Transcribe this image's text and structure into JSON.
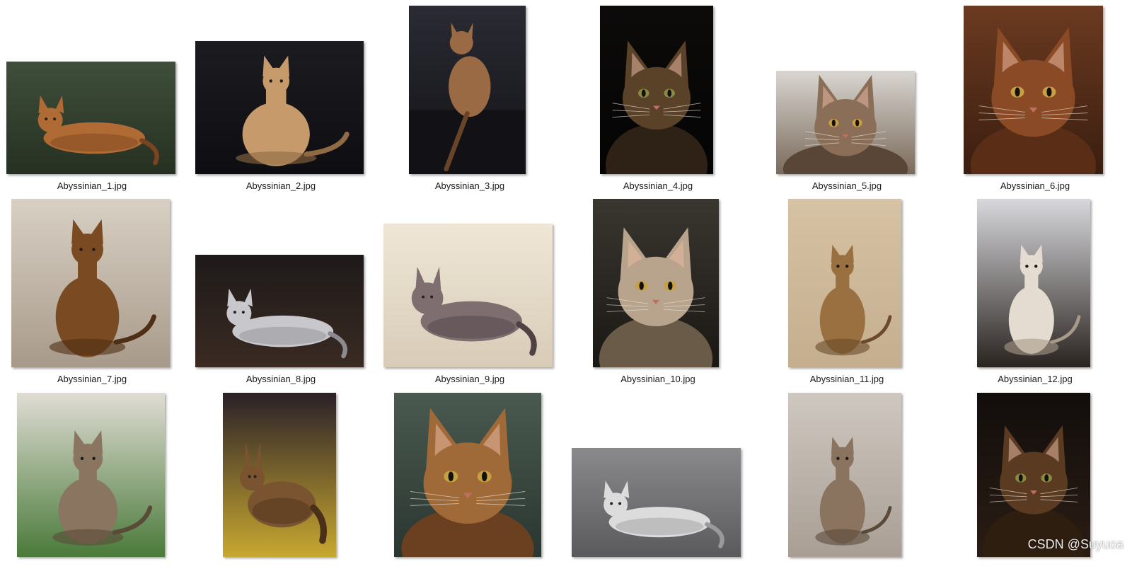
{
  "files": [
    {
      "name": "Abyssinian_1.jpg",
      "palette": {
        "bg": "#3f4f3a",
        "bg2": "#263022",
        "cat": "#b06a34",
        "cat2": "#7a4420"
      },
      "pose": "lying"
    },
    {
      "name": "Abyssinian_2.jpg",
      "palette": {
        "bg": "#1c1c20",
        "bg2": "#0e0e12",
        "cat": "#c69a6a",
        "cat2": "#8f6a44"
      },
      "pose": "sitting-tall"
    },
    {
      "name": "Abyssinian_3.jpg",
      "palette": {
        "bg": "#2a2b33",
        "bg2": "#121216",
        "cat": "#9a6a45",
        "cat2": "#6a4428"
      },
      "pose": "back"
    },
    {
      "name": "Abyssinian_4.jpg",
      "palette": {
        "bg": "#0c0b0a",
        "bg2": "#050404",
        "cat": "#5a4228",
        "cat2": "#2e2216"
      },
      "pose": "face-dark"
    },
    {
      "name": "Abyssinian_5.jpg",
      "palette": {
        "bg": "#d9d6d2",
        "bg2": "#7a6a5a",
        "cat": "#8a6e58",
        "cat2": "#5a4636"
      },
      "pose": "face-close"
    },
    {
      "name": "Abyssinian_6.jpg",
      "palette": {
        "bg": "#6b3a20",
        "bg2": "#3a1e10",
        "cat": "#8a4a26",
        "cat2": "#5a2e16"
      },
      "pose": "face-close"
    },
    {
      "name": "Abyssinian_7.jpg",
      "palette": {
        "bg": "#d8d0c4",
        "bg2": "#a89a8a",
        "cat": "#7a4a22",
        "cat2": "#4e2e14"
      },
      "pose": "sitting-tall"
    },
    {
      "name": "Abyssinian_8.jpg",
      "palette": {
        "bg": "#1e1a1a",
        "bg2": "#3a2a22",
        "cat": "#c8c8cc",
        "cat2": "#8a8a90"
      },
      "pose": "lying"
    },
    {
      "name": "Abyssinian_9.jpg",
      "palette": {
        "bg": "#efe6d6",
        "bg2": "#d8ccb8",
        "cat": "#7e6e70",
        "cat2": "#4e4244"
      },
      "pose": "lying"
    },
    {
      "name": "Abyssinian_10.jpg",
      "palette": {
        "bg": "#3a3630",
        "bg2": "#1a1814",
        "cat": "#b8a48c",
        "cat2": "#6a5a48"
      },
      "pose": "face-close"
    },
    {
      "name": "Abyssinian_11.jpg",
      "palette": {
        "bg": "#d6c2a4",
        "bg2": "#c4ae8e",
        "cat": "#9a7040",
        "cat2": "#6a4a28"
      },
      "pose": "sitting"
    },
    {
      "name": "Abyssinian_12.jpg",
      "palette": {
        "bg": "#d8d8dc",
        "bg2": "#2a2420",
        "cat": "#e4dcd0",
        "cat2": "#a89a88"
      },
      "pose": "sitting"
    },
    {
      "name": "",
      "palette": {
        "bg": "#e0ddd4",
        "bg2": "#4a7a3a",
        "cat": "#8a7660",
        "cat2": "#5a4a38"
      },
      "pose": "sitting"
    },
    {
      "name": "",
      "palette": {
        "bg": "#2a2028",
        "bg2": "#c8a830",
        "cat": "#7a5430",
        "cat2": "#4a3018"
      },
      "pose": "lying"
    },
    {
      "name": "",
      "palette": {
        "bg": "#4a5a50",
        "bg2": "#2a3630",
        "cat": "#a06a38",
        "cat2": "#6a4020"
      },
      "pose": "face-close"
    },
    {
      "name": "",
      "palette": {
        "bg": "#8a8a8c",
        "bg2": "#5a5a5c",
        "cat": "#dcdcdc",
        "cat2": "#9a9a9a"
      },
      "pose": "lying"
    },
    {
      "name": "",
      "palette": {
        "bg": "#cfc8c0",
        "bg2": "#a89e94",
        "cat": "#8a7460",
        "cat2": "#5a4a3a"
      },
      "pose": "sitting"
    },
    {
      "name": "",
      "palette": {
        "bg": "#120e0c",
        "bg2": "#2a1c14",
        "cat": "#5a3a20",
        "cat2": "#2e1e10"
      },
      "pose": "face-dark"
    }
  ],
  "watermark": "CSDN @Suyuoa"
}
